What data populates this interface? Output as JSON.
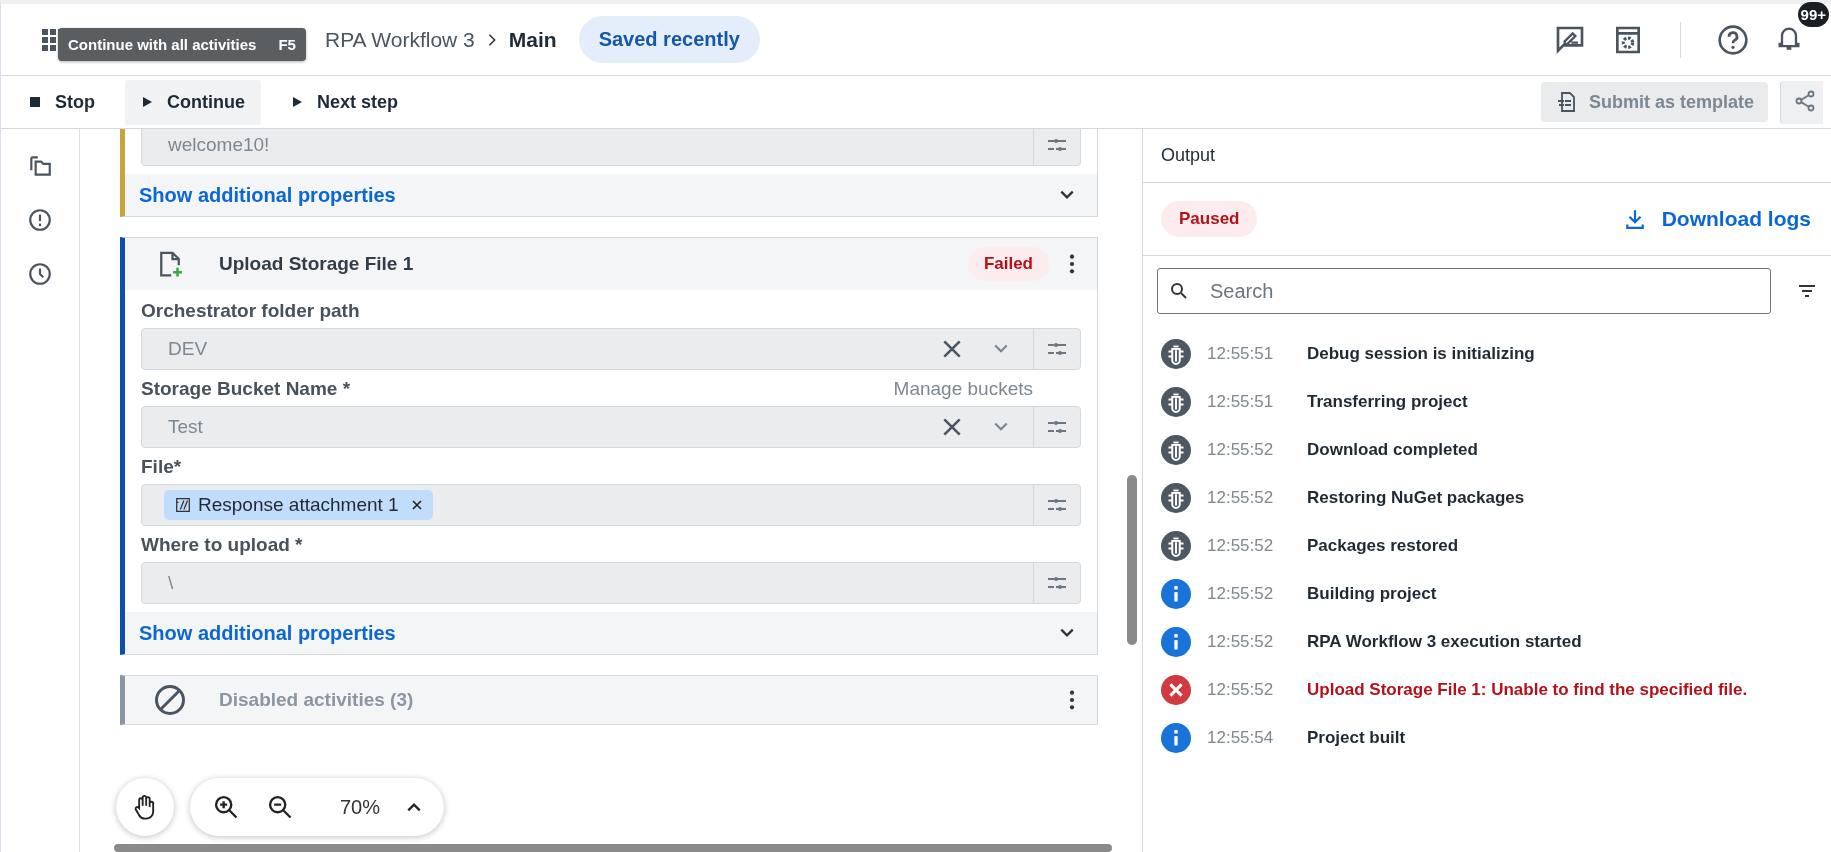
{
  "header": {
    "tooltip": {
      "label": "Continue with all activities",
      "shortcut": "F5"
    },
    "breadcrumb": [
      "RPA Workflow 3",
      "Main"
    ],
    "save_status": "Saved recently",
    "notifications_badge": "99+"
  },
  "toolbar": {
    "actions": [
      {
        "label": "Stop",
        "kind": "stop",
        "selected": false
      },
      {
        "label": "Continue",
        "kind": "play",
        "selected": true
      },
      {
        "label": "Next step",
        "kind": "play",
        "selected": false
      }
    ],
    "submit_template": {
      "label": "Submit as template",
      "disabled": true
    }
  },
  "canvas": {
    "cards": [
      {
        "kind": "partial",
        "color": "#c5a63a",
        "fields": [
          {
            "kind": "text",
            "value": "welcome10!"
          }
        ],
        "more_link": "Show additional properties"
      },
      {
        "kind": "activity",
        "color": "#0a4fae",
        "title": "Upload Storage File 1",
        "status": "Failed",
        "fields": [
          {
            "kind": "select",
            "label": "Orchestrator folder path",
            "value": "DEV"
          },
          {
            "kind": "select",
            "label": "Storage Bucket Name *",
            "link": "Manage buckets",
            "value": "Test"
          },
          {
            "kind": "chip",
            "label": "File*",
            "value": "Response attachment 1"
          },
          {
            "kind": "text",
            "label": "Where to upload *",
            "value": "\\"
          }
        ],
        "more_link": "Show additional properties"
      },
      {
        "kind": "disabled",
        "color": "#8a96a3",
        "title": "Disabled activities (3)"
      }
    ],
    "zoom": "70%"
  },
  "output": {
    "title": "Output",
    "status": "Paused",
    "download": "Download logs",
    "search": {
      "placeholder": "Search"
    },
    "logs": [
      {
        "kind": "debug",
        "time": "12:55:51",
        "message": "Debug session is initializing"
      },
      {
        "kind": "debug",
        "time": "12:55:51",
        "message": "Transferring project"
      },
      {
        "kind": "debug",
        "time": "12:55:52",
        "message": "Download completed"
      },
      {
        "kind": "debug",
        "time": "12:55:52",
        "message": "Restoring NuGet packages"
      },
      {
        "kind": "debug",
        "time": "12:55:52",
        "message": "Packages restored"
      },
      {
        "kind": "info",
        "time": "12:55:52",
        "message": "Building project"
      },
      {
        "kind": "info",
        "time": "12:55:52",
        "message": "RPA Workflow 3 execution started"
      },
      {
        "kind": "error",
        "time": "12:55:52",
        "message": "Upload Storage File 1: Unable to find the specified file."
      },
      {
        "kind": "info",
        "time": "12:55:54",
        "message": "Project built"
      }
    ]
  }
}
